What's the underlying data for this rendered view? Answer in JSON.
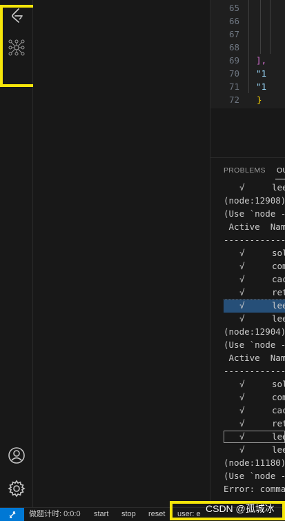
{
  "activity_bar": {
    "top_icons": [
      "leetcode-extension-icon",
      "tree-graph-icon"
    ],
    "bottom_icons": [
      "account-icon",
      "settings-gear-icon"
    ]
  },
  "editor": {
    "lines": [
      {
        "num": "65",
        "text": ""
      },
      {
        "num": "66",
        "text": ""
      },
      {
        "num": "67",
        "text": ""
      },
      {
        "num": "68",
        "text": ""
      },
      {
        "num": "69",
        "text": "  ],"
      },
      {
        "num": "70",
        "text": "  \"1"
      },
      {
        "num": "71",
        "text": "  \"1"
      },
      {
        "num": "72",
        "text": "}"
      }
    ]
  },
  "panel": {
    "tabs": [
      "PROBLEMS",
      "OU"
    ],
    "output": [
      {
        "kind": "row",
        "check": "√",
        "name": "lee"
      },
      {
        "kind": "text",
        "text": "(node:12908)"
      },
      {
        "kind": "text",
        "text": "(Use `node -"
      },
      {
        "kind": "text",
        "text": " Active  Nam"
      },
      {
        "kind": "text",
        "text": "------------"
      },
      {
        "kind": "row",
        "check": "√",
        "name": "sol"
      },
      {
        "kind": "row",
        "check": "√",
        "name": "com"
      },
      {
        "kind": "row",
        "check": "√",
        "name": "cac"
      },
      {
        "kind": "row",
        "check": "√",
        "name": "ret"
      },
      {
        "kind": "row",
        "check": "√",
        "name": "lee",
        "highlight": "filled"
      },
      {
        "kind": "row",
        "check": "√",
        "name": "lee"
      },
      {
        "kind": "text",
        "text": "(node:12904)"
      },
      {
        "kind": "text",
        "text": "(Use `node -"
      },
      {
        "kind": "text",
        "text": " Active  Nam"
      },
      {
        "kind": "text",
        "text": "------------"
      },
      {
        "kind": "row",
        "check": "√",
        "name": "sol"
      },
      {
        "kind": "row",
        "check": "√",
        "name": "com"
      },
      {
        "kind": "row",
        "check": "√",
        "name": "cac"
      },
      {
        "kind": "row",
        "check": "√",
        "name": "ret"
      },
      {
        "kind": "row",
        "check": "√",
        "name": "lee",
        "highlight": "outline"
      },
      {
        "kind": "row",
        "check": "√",
        "name": "lee"
      },
      {
        "kind": "text",
        "text": "(node:11180)"
      },
      {
        "kind": "text",
        "text": "(Use `node -"
      },
      {
        "kind": "text",
        "text": "Error: comma"
      }
    ]
  },
  "status_bar": {
    "remote_icon": "remote-icon",
    "timer_label": "做题计时: 0:0:0",
    "start": "start",
    "stop": "stop",
    "reset": "reset",
    "user": "user: e"
  },
  "watermark": "CSDN @孤城冰",
  "colors": {
    "highlight_box": "#f5e50a",
    "remote_blue": "#0078d4",
    "selection": "#264f78"
  }
}
